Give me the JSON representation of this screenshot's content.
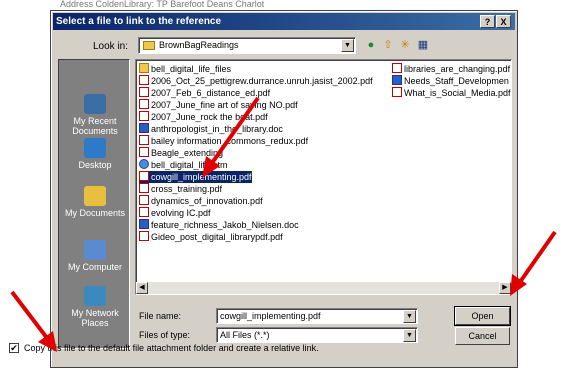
{
  "background_text": "Address          ColdenLibrary: TP    Barefoot Deans       Charlot",
  "dialog": {
    "title": "Select a file to link to the reference",
    "help_label": "?",
    "close_label": "X"
  },
  "lookin": {
    "label": "Look in:",
    "value": "BrownBagReadings",
    "dropdown_glyph": "▼"
  },
  "toolbar": {
    "back_glyph": "●",
    "up_glyph": "⇧",
    "new_folder_glyph": "✳",
    "view_menu_glyph": "▦"
  },
  "places": [
    {
      "label": "My Recent Documents",
      "icon": "recent-documents-icon"
    },
    {
      "label": "Desktop",
      "icon": "desktop-icon"
    },
    {
      "label": "My Documents",
      "icon": "my-documents-icon"
    },
    {
      "label": "My Computer",
      "icon": "my-computer-icon"
    },
    {
      "label": "My Network Places",
      "icon": "network-places-icon"
    }
  ],
  "files_col1": [
    {
      "name": "bell_digital_life_files",
      "type": "folder"
    },
    {
      "name": "2006_Oct_25_pettigrew.durrance.unruh.jasist_2002.pdf",
      "type": "pdf"
    },
    {
      "name": "2007_Feb_6_distance_ed.pdf",
      "type": "pdf"
    },
    {
      "name": "2007_June_fine art of saying NO.pdf",
      "type": "pdf"
    },
    {
      "name": "2007_June_rock the boat.pdf",
      "type": "pdf"
    },
    {
      "name": "anthropologist_in_the_library.doc",
      "type": "doc"
    },
    {
      "name": "bailey information_commons_redux.pdf",
      "type": "pdf"
    },
    {
      "name": "Beagle_extending",
      "type": "pdf"
    },
    {
      "name": "bell_digital_life.htm",
      "type": "htm"
    },
    {
      "name": "cowgill_implementing.pdf",
      "type": "pdf",
      "selected": true
    },
    {
      "name": "cross_training.pdf",
      "type": "pdf"
    },
    {
      "name": "dynamics_of_innovation.pdf",
      "type": "pdf"
    },
    {
      "name": "evolving IC.pdf",
      "type": "pdf"
    },
    {
      "name": "feature_richness_Jakob_Nielsen.doc",
      "type": "doc"
    },
    {
      "name": "Gideo_post_digital_librarypdf.pdf",
      "type": "pdf"
    }
  ],
  "files_col2": [
    {
      "name": "libraries_are_changing.pdf",
      "type": "pdf"
    },
    {
      "name": "Needs_Staff_Developmen",
      "type": "doc"
    },
    {
      "name": "What_is_Social_Media.pdf",
      "type": "pdf"
    }
  ],
  "scroll": {
    "left": "◀",
    "right": "▶"
  },
  "filename": {
    "label": "File name:",
    "value": "cowgill_implementing.pdf"
  },
  "filetype": {
    "label": "Files of type:",
    "value": "All Files (*.*)"
  },
  "buttons": {
    "open": "Open",
    "cancel": "Cancel"
  },
  "checkbox": {
    "checked_glyph": "✔",
    "label": "Copy this file to the default file attachment folder and create a relative link."
  },
  "colors": {
    "titlebar": "#0a246a",
    "selection": "#0a246a",
    "arrow": "#e00000",
    "dialog": "#d4d0c8"
  }
}
